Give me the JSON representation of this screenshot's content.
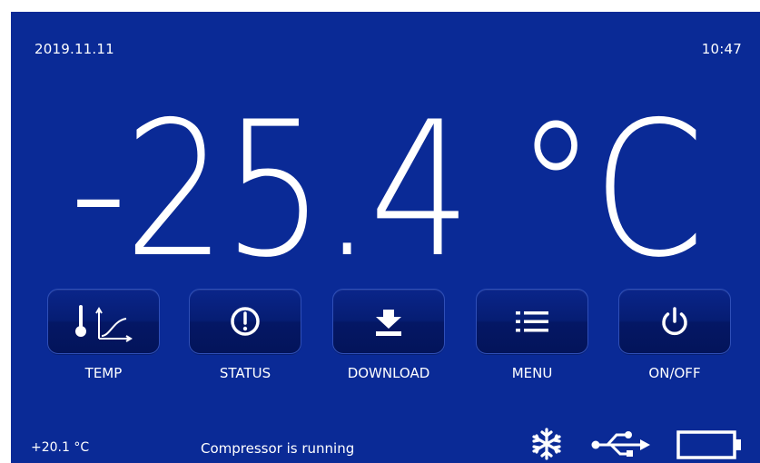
{
  "header": {
    "date": "2019.11.11",
    "time": "10:47"
  },
  "main": {
    "temperature": "-25.4 °C"
  },
  "buttons": [
    {
      "label": "TEMP",
      "icon": "thermometer-graph-icon"
    },
    {
      "label": "STATUS",
      "icon": "alert-circle-icon"
    },
    {
      "label": "DOWNLOAD",
      "icon": "download-icon"
    },
    {
      "label": "MENU",
      "icon": "menu-icon"
    },
    {
      "label": "ON/OFF",
      "icon": "power-icon"
    }
  ],
  "footer": {
    "ambient_temp": "+20.1 °C",
    "status_message": "Compressor is running",
    "icons": [
      "snowflake-icon",
      "usb-icon",
      "battery-icon"
    ]
  },
  "colors": {
    "background": "#0a2a96",
    "button": "#061d73",
    "text": "#ffffff"
  }
}
